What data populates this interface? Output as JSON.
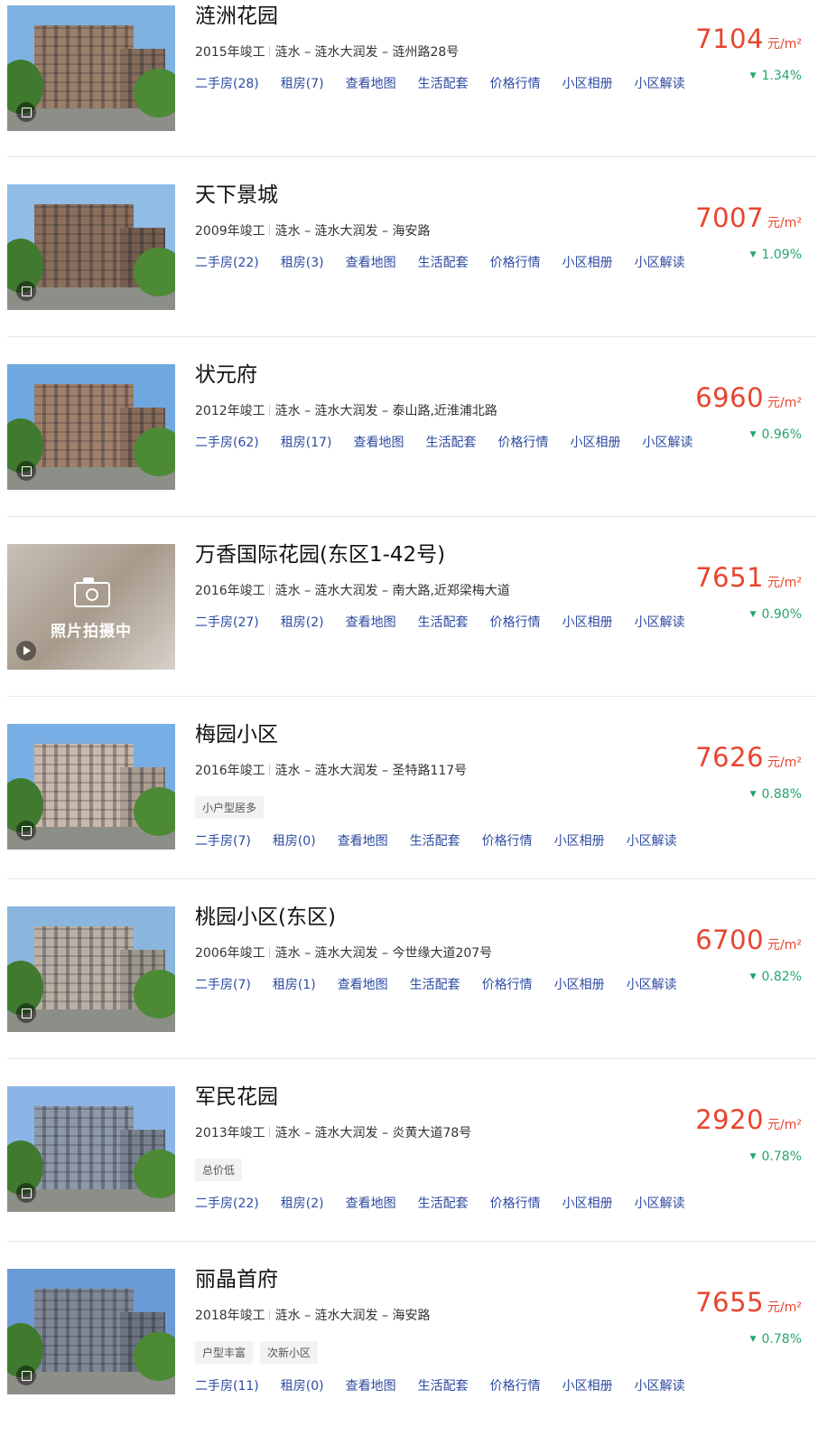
{
  "communities": [
    {
      "name": "涟洲花园",
      "year": "2015年竣工",
      "district": "涟水",
      "area": "涟水大润发",
      "address": "涟州路28号",
      "tags": [],
      "links": [
        "二手房(28)",
        "租房(7)",
        "查看地图",
        "生活配套",
        "价格行情",
        "小区相册",
        "小区解读"
      ],
      "price": "7104",
      "unit": "元/m²",
      "change": "1.34%",
      "photo": "building",
      "badge": "album-icon"
    },
    {
      "name": "天下景城",
      "year": "2009年竣工",
      "district": "涟水",
      "area": "涟水大润发",
      "address": "海安路",
      "tags": [],
      "links": [
        "二手房(22)",
        "租房(3)",
        "查看地图",
        "生活配套",
        "价格行情",
        "小区相册",
        "小区解读"
      ],
      "price": "7007",
      "unit": "元/m²",
      "change": "1.09%",
      "photo": "building",
      "badge": "album-icon"
    },
    {
      "name": "状元府",
      "year": "2012年竣工",
      "district": "涟水",
      "area": "涟水大润发",
      "address": "泰山路,近淮浦北路",
      "tags": [],
      "links": [
        "二手房(62)",
        "租房(17)",
        "查看地图",
        "生活配套",
        "价格行情",
        "小区相册",
        "小区解读"
      ],
      "price": "6960",
      "unit": "元/m²",
      "change": "0.96%",
      "photo": "building",
      "badge": "album-icon"
    },
    {
      "name": "万香国际花园(东区1-42号)",
      "year": "2016年竣工",
      "district": "涟水",
      "area": "涟水大润发",
      "address": "南大路,近郑梁梅大道",
      "tags": [],
      "links": [
        "二手房(27)",
        "租房(2)",
        "查看地图",
        "生活配套",
        "价格行情",
        "小区相册",
        "小区解读"
      ],
      "price": "7651",
      "unit": "元/m²",
      "change": "0.90%",
      "photo": "placeholder",
      "placeholder_text": "照片拍摄中",
      "badge": "play-icon"
    },
    {
      "name": "梅园小区",
      "year": "2016年竣工",
      "district": "涟水",
      "area": "涟水大润发",
      "address": "圣特路117号",
      "tags": [
        "小户型居多"
      ],
      "links": [
        "二手房(7)",
        "租房(0)",
        "查看地图",
        "生活配套",
        "价格行情",
        "小区相册",
        "小区解读"
      ],
      "price": "7626",
      "unit": "元/m²",
      "change": "0.88%",
      "photo": "building",
      "badge": "album-icon"
    },
    {
      "name": "桃园小区(东区)",
      "year": "2006年竣工",
      "district": "涟水",
      "area": "涟水大润发",
      "address": "今世缘大道207号",
      "tags": [],
      "links": [
        "二手房(7)",
        "租房(1)",
        "查看地图",
        "生活配套",
        "价格行情",
        "小区相册",
        "小区解读"
      ],
      "price": "6700",
      "unit": "元/m²",
      "change": "0.82%",
      "photo": "building",
      "badge": "album-icon"
    },
    {
      "name": "军民花园",
      "year": "2013年竣工",
      "district": "涟水",
      "area": "涟水大润发",
      "address": "炎黄大道78号",
      "tags": [
        "总价低"
      ],
      "links": [
        "二手房(22)",
        "租房(2)",
        "查看地图",
        "生活配套",
        "价格行情",
        "小区相册",
        "小区解读"
      ],
      "price": "2920",
      "unit": "元/m²",
      "change": "0.78%",
      "photo": "building",
      "badge": "album-icon"
    },
    {
      "name": "丽晶首府",
      "year": "2018年竣工",
      "district": "涟水",
      "area": "涟水大润发",
      "address": "海安路",
      "tags": [
        "户型丰富",
        "次新小区"
      ],
      "links": [
        "二手房(11)",
        "租房(0)",
        "查看地图",
        "生活配套",
        "价格行情",
        "小区相册",
        "小区解读"
      ],
      "price": "7655",
      "unit": "元/m²",
      "change": "0.78%",
      "photo": "building",
      "badge": "album-icon"
    }
  ],
  "colors": {
    "price": "#e8452f",
    "change_down": "#23a66a",
    "link": "#2c4aa1"
  },
  "icons": {
    "change_direction": "triangle-down-icon"
  }
}
